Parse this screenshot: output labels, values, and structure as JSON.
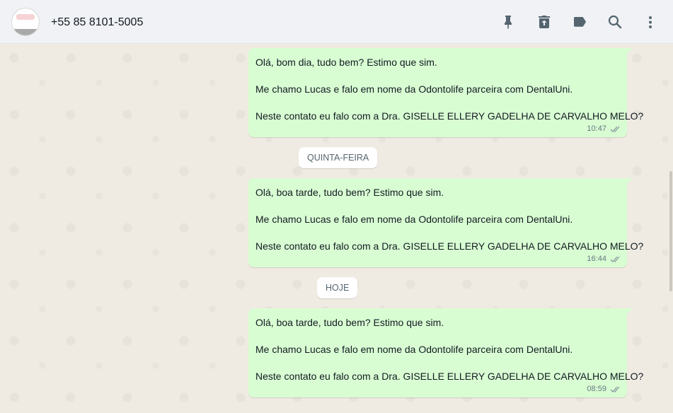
{
  "header": {
    "contact_name": "+55 85 8101-5005",
    "icons": [
      "pin-icon",
      "archive-icon",
      "label-icon",
      "search-icon",
      "menu-icon"
    ]
  },
  "messages": [
    {
      "lines": [
        "Olá, bom dia, tudo bem? Estimo que sim.",
        "Me chamo Lucas e falo em nome da Odontolife parceira com DentalUni.",
        "Neste contato eu falo com a Dra. GISELLE ELLERY GADELHA DE CARVALHO MELO?"
      ],
      "time": "10:47",
      "status": "read"
    },
    {
      "lines": [
        "Olá, boa tarde, tudo bem? Estimo que sim.",
        "Me chamo Lucas e falo em nome da Odontolife parceira com DentalUni.",
        "Neste contato eu falo com a Dra. GISELLE ELLERY GADELHA DE CARVALHO MELO?"
      ],
      "time": "16:44",
      "status": "read"
    },
    {
      "lines": [
        "Olá, boa tarde, tudo bem? Estimo que sim.",
        "Me chamo Lucas e falo em nome da Odontolife parceira com DentalUni.",
        "Neste contato eu falo com a Dra. GISELLE ELLERY GADELHA DE CARVALHO MELO?"
      ],
      "time": "08:59",
      "status": "read"
    }
  ],
  "date_dividers": [
    "QUINTA-FEIRA",
    "HOJE"
  ],
  "colors": {
    "header_bg": "#f0f2f5",
    "chat_bg": "#efeae2",
    "outgoing_bubble": "#d9fdd3",
    "ticks": "#8696a0"
  }
}
